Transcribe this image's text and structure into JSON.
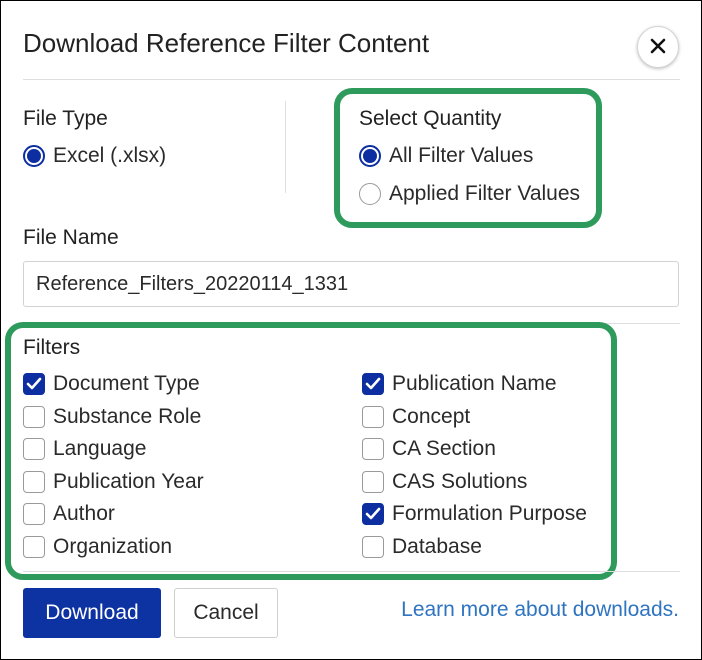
{
  "dialog": {
    "title": "Download Reference Filter Content",
    "close_icon": "close-icon"
  },
  "file_type": {
    "label": "File Type",
    "options": [
      {
        "label": "Excel (.xlsx)",
        "selected": true
      }
    ]
  },
  "select_quantity": {
    "label": "Select Quantity",
    "options": [
      {
        "label": "All Filter Values",
        "selected": true
      },
      {
        "label": "Applied Filter Values",
        "selected": false
      }
    ]
  },
  "file_name": {
    "label": "File Name",
    "value": "Reference_Filters_20220114_1331"
  },
  "filters": {
    "label": "Filters",
    "left": [
      {
        "label": "Document Type",
        "checked": true
      },
      {
        "label": "Substance Role",
        "checked": false
      },
      {
        "label": "Language",
        "checked": false
      },
      {
        "label": "Publication Year",
        "checked": false
      },
      {
        "label": "Author",
        "checked": false
      },
      {
        "label": "Organization",
        "checked": false
      }
    ],
    "right": [
      {
        "label": "Publication Name",
        "checked": true
      },
      {
        "label": "Concept",
        "checked": false
      },
      {
        "label": "CA Section",
        "checked": false
      },
      {
        "label": "CAS Solutions",
        "checked": false
      },
      {
        "label": "Formulation Purpose",
        "checked": true
      },
      {
        "label": "Database",
        "checked": false
      }
    ]
  },
  "footer": {
    "download_label": "Download",
    "cancel_label": "Cancel",
    "learn_more_label": "Learn more about downloads."
  },
  "colors": {
    "primary": "#0d33a3",
    "highlight": "#2e9a5c",
    "link": "#2f74c0"
  }
}
